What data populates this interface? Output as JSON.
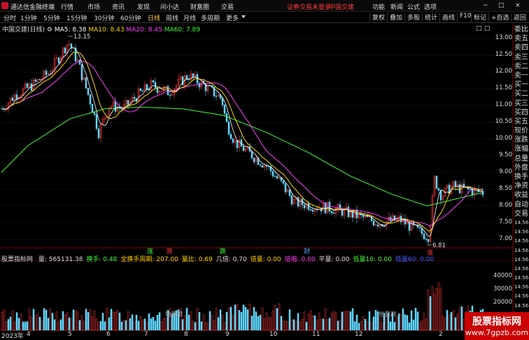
{
  "titlebar": {
    "app_name": "通达信金融终端",
    "menus": [
      "行情",
      "市场",
      "资讯",
      "发现",
      "问小达",
      "财富圈",
      "交易"
    ],
    "alert": "证券交易未登录",
    "stock_link": "中国交建",
    "right_items": [
      "功能",
      "新闻",
      "公式",
      "选项"
    ],
    "window_buttons": [
      "−",
      "□",
      "×"
    ]
  },
  "toolbar": {
    "periods": [
      "分时",
      "1分钟",
      "5分钟",
      "15分钟",
      "30分钟",
      "60分钟",
      "日线",
      "周线",
      "月线",
      "多周期",
      "更多"
    ],
    "active_period": "日线",
    "right_buttons": [
      "复权",
      "叠加",
      "多股",
      "统计",
      "画线",
      "F10",
      "标记",
      "+自选",
      "返回"
    ]
  },
  "main_chart": {
    "title": "中国交建(日线)",
    "ma5": "MA5: 8.38",
    "ma10": "MA10: 8.43",
    "ma20": "MA20: 8.45",
    "ma60": "MA60: 7.89",
    "high_label": "13.15",
    "low_label": "6.81",
    "y_ticks": [
      "13.00",
      "12.50",
      "12.00",
      "11.50",
      "11.00",
      "10.50",
      "10.00",
      "9.50",
      "9.00",
      "8.50",
      "8.00",
      "7.50",
      "7.00"
    ],
    "signal_marks": [
      {
        "text": "涨",
        "color": "#40ff40"
      },
      {
        "text": "跌",
        "color": "#ff3b3b"
      },
      {
        "text": "跌",
        "color": "#40ff40"
      },
      {
        "text": "财",
        "color": "#4aa3ff"
      },
      {
        "text": "涨",
        "color": "#ff3b3b"
      }
    ]
  },
  "indicator": {
    "name": "股票指标网",
    "items": [
      {
        "text": "量: 565131.38",
        "color": "#dddddd"
      },
      {
        "text": "换手: 0.48",
        "color": "#40ff40"
      },
      {
        "text": "全换手周期: 207.00",
        "color": "#ffd700"
      },
      {
        "text": "量比: 0.69",
        "color": "#ffd700"
      },
      {
        "text": "几倍: 0.70",
        "color": "#dddddd"
      },
      {
        "text": "倍量: 0.00",
        "color": "#ffd700"
      },
      {
        "text": "倍缩: 0.00",
        "color": "#ff40ff"
      },
      {
        "text": "平量: 0.00",
        "color": "#dddddd"
      },
      {
        "text": "低量10: 0.00",
        "color": "#40ff40"
      },
      {
        "text": "低量60: 0.00",
        "color": "#4060ff"
      }
    ],
    "y_ticks": [
      "40000",
      "30000",
      "20000",
      "10000"
    ],
    "annotations": [
      "地量群",
      "地量群"
    ]
  },
  "x_axis": [
    "2023年",
    "4",
    "5",
    "6",
    "7",
    "8",
    "9",
    "10",
    "11",
    "12",
    "2"
  ],
  "side_panel": [
    "委比",
    "卖五",
    "卖四",
    "卖三",
    "卖二",
    "卖一",
    "买一",
    "买二",
    "买三",
    "买四",
    "买五",
    "现价",
    "涨跌",
    "涨幅",
    "总量",
    "外盘",
    "换手",
    "净资",
    "收益",
    "自动",
    "交易",
    "14:56",
    "14:56",
    "14:56",
    "14:56",
    "14:56",
    "14:56",
    "14:56",
    "14:56",
    "14:56",
    "14:56",
    "14:56",
    "14:56",
    "14:56"
  ],
  "watermark": {
    "line1": "股票指标网",
    "line2": "www.7gpzb.com"
  }
}
